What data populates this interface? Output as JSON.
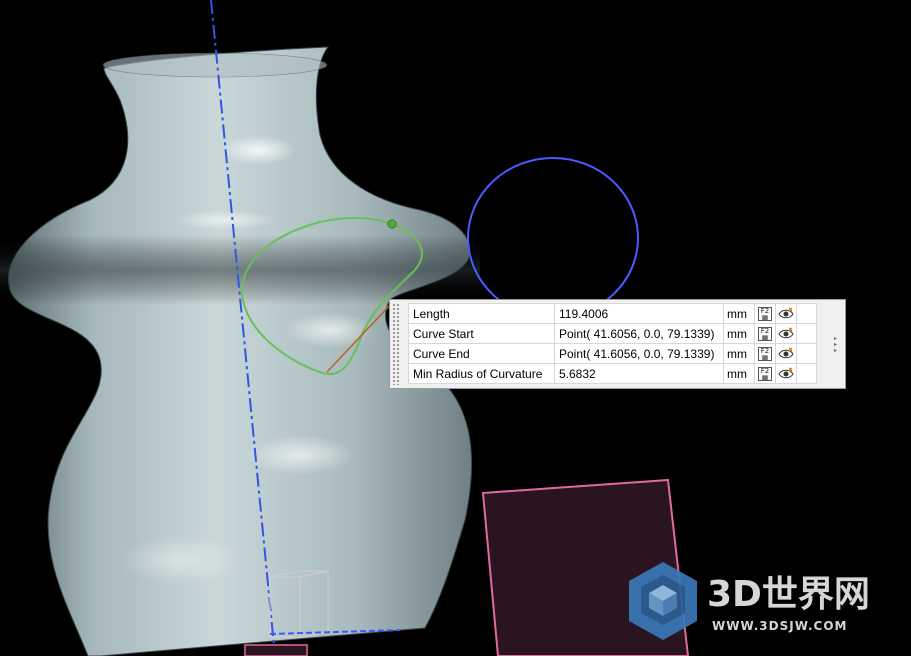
{
  "measurement_panel": {
    "rows": [
      {
        "label": "Length",
        "value": "119.4006",
        "unit": "mm"
      },
      {
        "label": "Curve Start",
        "value": "Point( 41.6056, 0.0, 79.1339)",
        "unit": "mm"
      },
      {
        "label": "Curve End",
        "value": "Point( 41.6056, 0.0, 79.1339)",
        "unit": "mm"
      },
      {
        "label": "Min Radius of Curvature",
        "value": "5.6832",
        "unit": "mm"
      }
    ],
    "row_icons": [
      "calculator-icon",
      "visibility-eye-icon"
    ]
  },
  "watermark": {
    "brand": "3D世界网",
    "url": "WWW.3DSJW.COM"
  },
  "colors": {
    "background": "#000000",
    "vase_surface": "#9fb2b6",
    "selected_curve": "#6abf5a",
    "circle_curve": "#4a5cff",
    "datum_plane": "#e06a9e",
    "axis_line": "#2f57e0",
    "panel_bg": "#f0f0f0"
  }
}
